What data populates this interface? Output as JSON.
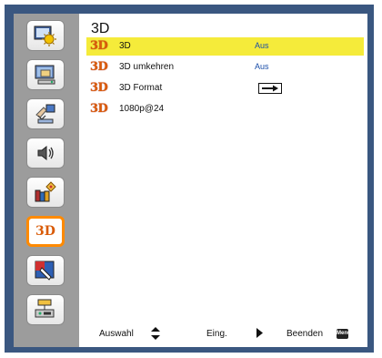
{
  "window": {
    "title": "3D"
  },
  "sidebar": {
    "items": [
      {
        "name": "picture-settings",
        "icon": "picture-sun-icon",
        "active": false
      },
      {
        "name": "display-settings",
        "icon": "display-screen-icon",
        "active": false
      },
      {
        "name": "setup-settings",
        "icon": "hand-wrench-icon",
        "active": false
      },
      {
        "name": "audio-settings",
        "icon": "speaker-icon",
        "active": false
      },
      {
        "name": "options-settings",
        "icon": "books-diamond-icon",
        "active": false
      },
      {
        "name": "3d-settings",
        "icon": "3d-icon",
        "label": "3D",
        "active": true
      },
      {
        "name": "interactive-settings",
        "icon": "pen-touch-icon",
        "active": false
      },
      {
        "name": "network-settings",
        "icon": "network-lan-icon",
        "active": false
      }
    ]
  },
  "menu": {
    "icon_text": "3D",
    "rows": [
      {
        "label": "3D",
        "value": "Aus",
        "selected": true
      },
      {
        "label": "3D umkehren",
        "value": "Aus",
        "selected": false
      },
      {
        "label": "3D Format",
        "value_icon": "arrow-right-icon",
        "selected": false
      },
      {
        "label": "1080p@24",
        "selected": false
      }
    ]
  },
  "footer": {
    "select_label": "Auswahl",
    "enter_label": "Eing.",
    "exit_label": "Beenden",
    "menu_key": "Menu"
  },
  "colors": {
    "frame": "#3a5780",
    "sidebar": "#9c9c9c",
    "selected_row": "#f5eb3a",
    "active_border": "#ff8a00",
    "value_text": "#1a4ea8",
    "icon_3d": "#d95b07"
  }
}
